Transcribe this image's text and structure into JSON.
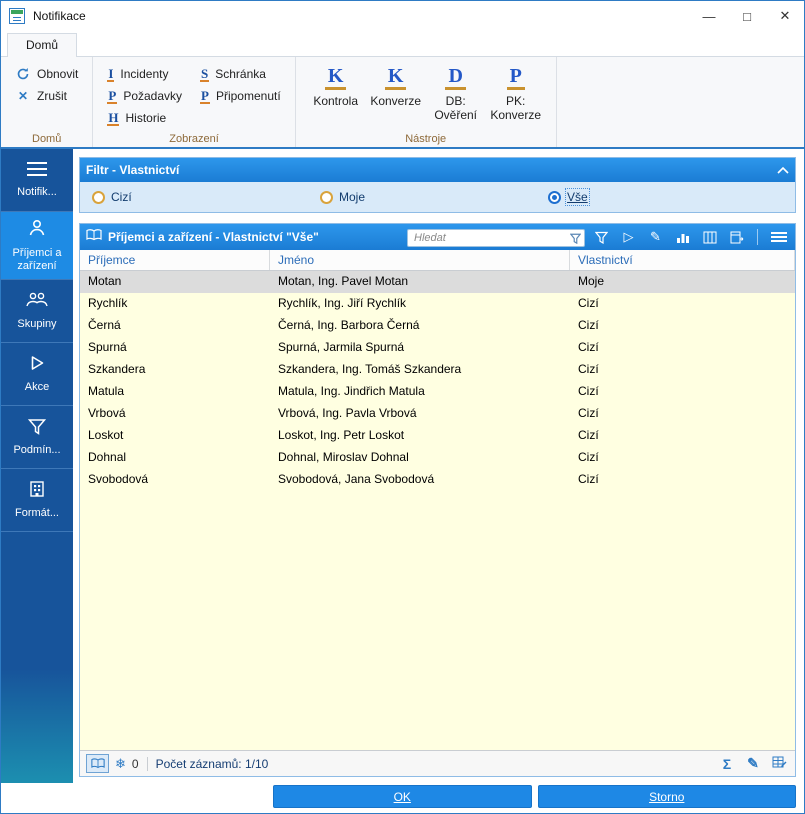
{
  "colors": {
    "accent_blue": "#1E88E5",
    "sidebar_blue": "#17549B",
    "sidebar_selected_blue": "#1E8BE4",
    "panel_header_blue": "#1F87E0",
    "row_yellow": "#FFFFE1",
    "selected_row_gray": "#DCDCDC",
    "column_header_text_blue": "#2B6CB8",
    "ribbon_group_label_brown": "#8E6A3A"
  },
  "window": {
    "title": "Notifikace",
    "controls": {
      "minimize": "—",
      "maximize": "□",
      "close": "✕"
    }
  },
  "ribbon": {
    "active_tab": "Domů",
    "groups": [
      {
        "label": "Domů",
        "buttons": [
          {
            "label": "Obnovit",
            "icon": "refresh-icon"
          },
          {
            "label": "Zrušit",
            "icon": "cancel-icon"
          }
        ]
      },
      {
        "label": "Zobrazení",
        "buttons": [
          {
            "label": "Incidenty",
            "letter": "I"
          },
          {
            "label": "Požadavky",
            "letter": "P"
          },
          {
            "label": "Historie",
            "letter": "H"
          },
          {
            "label": "Schránka",
            "letter": "S"
          },
          {
            "label": "Připomenutí",
            "letter": "P"
          }
        ]
      },
      {
        "label": "Nástroje",
        "buttons": [
          {
            "label": "Kontrola",
            "letter": "K"
          },
          {
            "label": "Konverze",
            "letter": "K"
          },
          {
            "label": "DB: Ověření",
            "letter": "D"
          },
          {
            "label": "PK: Konverze",
            "letter": "P"
          }
        ]
      }
    ]
  },
  "sidebar": {
    "items": [
      {
        "label": "Notifik...",
        "icon": "list-icon",
        "selected": false
      },
      {
        "label": "Příjemci a zařízení",
        "icon": "person-icon",
        "selected": true
      },
      {
        "label": "Skupiny",
        "icon": "people-icon",
        "selected": false
      },
      {
        "label": "Akce",
        "icon": "play-icon",
        "selected": false
      },
      {
        "label": "Podmín...",
        "icon": "filter-icon",
        "selected": false
      },
      {
        "label": "Formát...",
        "icon": "building-icon",
        "selected": false
      }
    ]
  },
  "filter_panel": {
    "title": "Filtr - Vlastnictví",
    "options": [
      {
        "label": "Cizí",
        "selected": false
      },
      {
        "label": "Moje",
        "selected": false
      },
      {
        "label": "Vše",
        "selected": true
      }
    ]
  },
  "table_panel": {
    "title": "Příjemci a zařízení - Vlastnictví \"Vše\"",
    "search_placeholder": "Hledat",
    "columns": [
      "Příjemce",
      "Jméno",
      "Vlastnictví"
    ],
    "selected_row": 0,
    "rows": [
      [
        "Motan",
        "Motan, Ing. Pavel Motan",
        "Moje"
      ],
      [
        "Rychlík",
        "Rychlík, Ing. Jiří Rychlík",
        "Cizí"
      ],
      [
        "Černá",
        "Černá, Ing. Barbora Černá",
        "Cizí"
      ],
      [
        "Spurná",
        "Spurná, Jarmila Spurná",
        "Cizí"
      ],
      [
        "Szkandera",
        "Szkandera, Ing. Tomáš Szkandera",
        "Cizí"
      ],
      [
        "Matula",
        "Matula, Ing. Jindřich Matula",
        "Cizí"
      ],
      [
        "Vrbová",
        "Vrbová, Ing. Pavla Vrbová",
        "Cizí"
      ],
      [
        "Loskot",
        "Loskot, Ing. Petr Loskot",
        "Cizí"
      ],
      [
        "Dohnal",
        "Dohnal, Miroslav Dohnal",
        "Cizí"
      ],
      [
        "Svobodová",
        "Svobodová, Jana Svobodová",
        "Cizí"
      ]
    ],
    "status": {
      "badge_count": "0",
      "records_label": "Počet záznamů: 1/10"
    }
  },
  "footer": {
    "ok_label": "OK",
    "cancel_label": "Storno"
  }
}
